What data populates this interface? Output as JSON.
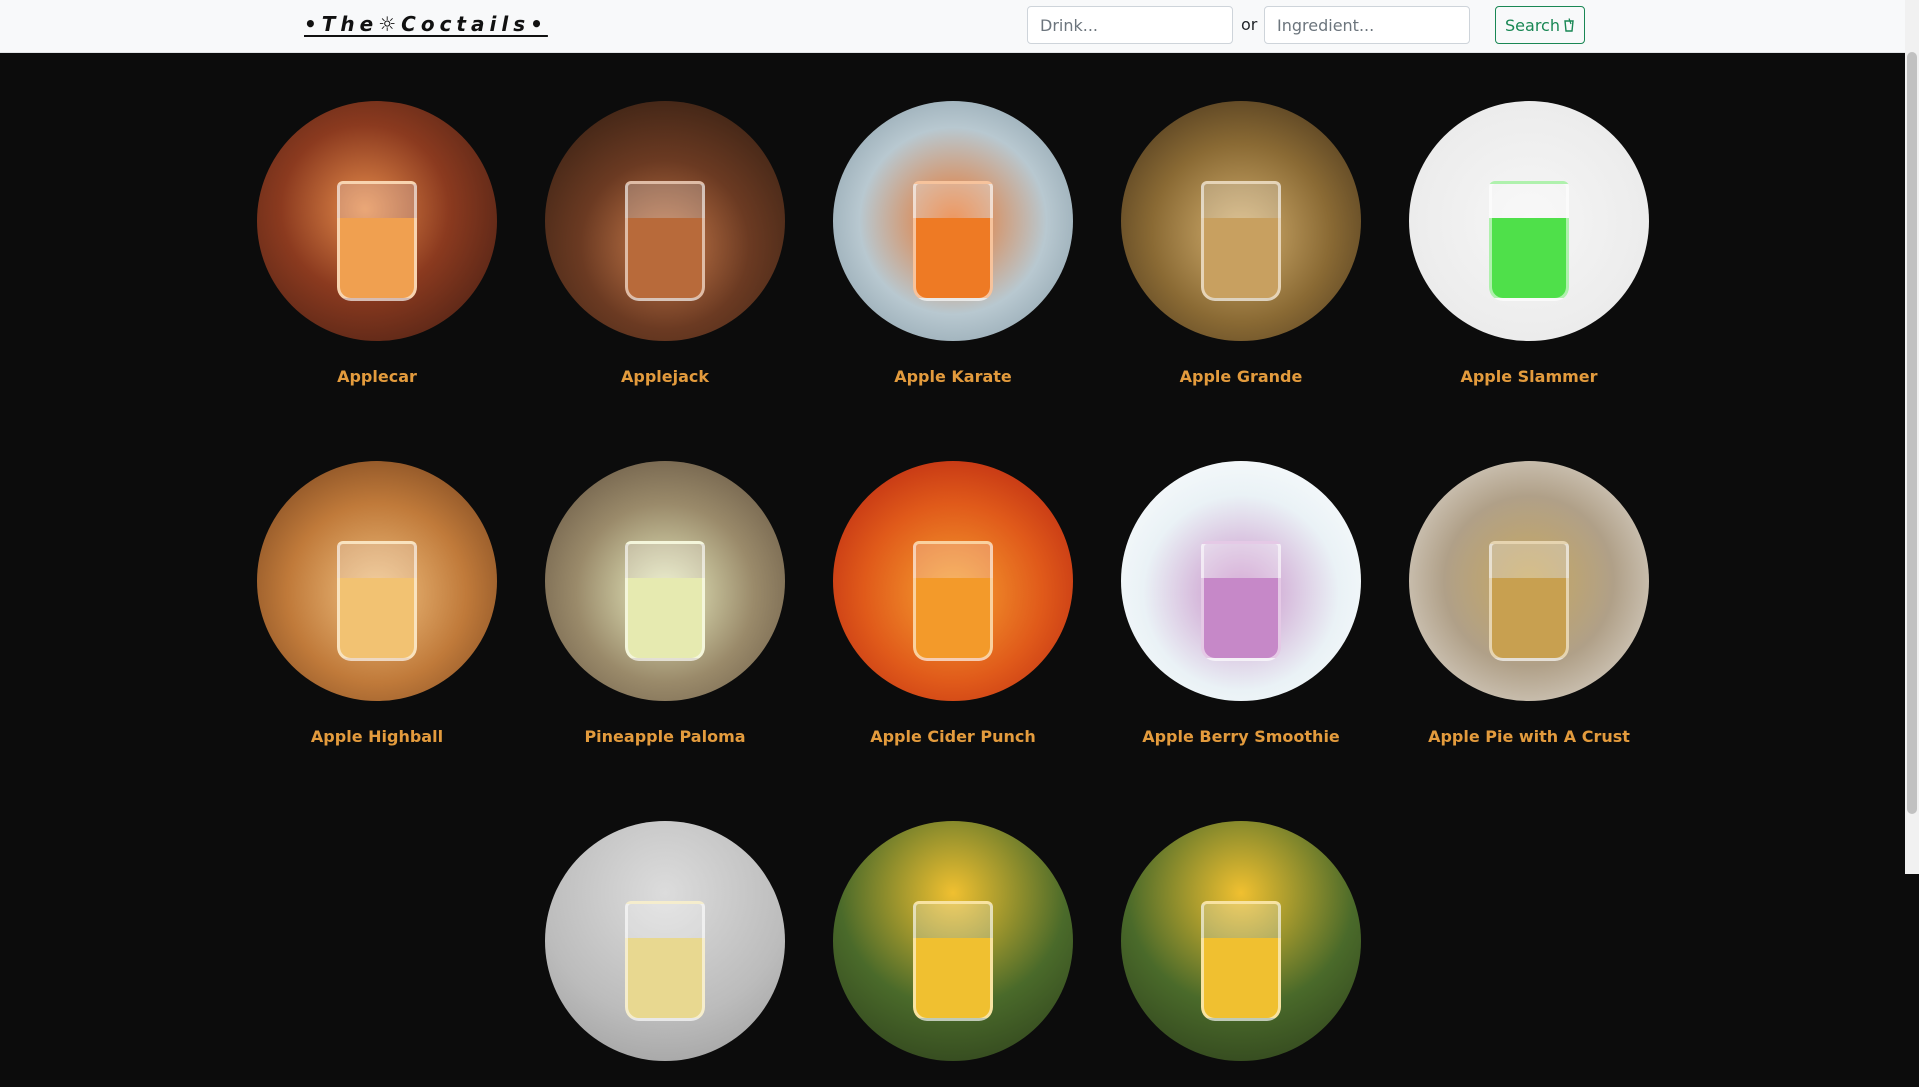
{
  "brand": "•The☼Coctails•",
  "search": {
    "drink_placeholder": "Drink...",
    "or_text": "or",
    "ingredient_placeholder": "Ingredient...",
    "button_label": "Search"
  },
  "drinks": [
    {
      "name": "Applecar",
      "bg": "radial-gradient(circle at 45% 45%, #e48a4a 0%, #8b3a1f 45%, #3a1a12 100%)",
      "liquid": "#f0a050"
    },
    {
      "name": "Applejack",
      "bg": "radial-gradient(circle at 50% 60%, #c77a4a 0%, #6b3a22 45%, #2a1a10 100%)",
      "liquid": "#b86a3a"
    },
    {
      "name": "Apple Karate",
      "bg": "radial-gradient(circle at 50% 50%, #e8742a 0%, #b8c8d0 55%, #7e94a0 100%)",
      "liquid": "#ee7a24"
    },
    {
      "name": "Apple Grande",
      "bg": "radial-gradient(circle at 50% 55%, #d4b070 0%, #8a6a34 50%, #3a2a18 100%)",
      "liquid": "#c8a060"
    },
    {
      "name": "Apple Slammer",
      "bg": "radial-gradient(circle at 50% 50%, #f6f6f6 0%, #ececec 70%, #dcdcdc 100%)",
      "liquid": "#4fe04a"
    },
    {
      "name": "Apple Highball",
      "bg": "radial-gradient(circle at 50% 55%, #f0c080 0%, #c07a3a 50%, #6a3a1a 100%)",
      "liquid": "#f2c272"
    },
    {
      "name": "Pineapple Paloma",
      "bg": "radial-gradient(circle at 50% 55%, #e8ecc0 0%, #9a8a6a 50%, #5a4a3a 100%)",
      "liquid": "#e6eab0"
    },
    {
      "name": "Apple Cider Punch",
      "bg": "radial-gradient(circle at 50% 55%, #f6a030 0%, #e05a1a 50%, #b01a10 100%)",
      "liquid": "#f39a2a"
    },
    {
      "name": "Apple Berry Smoothie",
      "bg": "radial-gradient(circle at 50% 55%, #c890c8 0%, #eaf2f6 55%, #ffffff 100%)",
      "liquid": "#c688c8"
    },
    {
      "name": "Apple Pie with A Crust",
      "bg": "radial-gradient(circle at 50% 50%, #c8a860 0%, #b0a088 50%, #e8e4de 100%)",
      "liquid": "#c8a050"
    },
    {
      "name": "",
      "bg": "radial-gradient(circle at 50% 30%, #dcdcdc 0%, #bcbcbc 60%, #9a9a9a 100%)",
      "liquid": "#e8d890"
    },
    {
      "name": "",
      "bg": "radial-gradient(circle at 50% 30%, #f0c030 0%, #4a6a2a 55%, #2a3a1a 100%)",
      "liquid": "#f0c030"
    },
    {
      "name": "",
      "bg": "radial-gradient(circle at 50% 30%, #f0c030 0%, #4a6a2a 55%, #2a3a1a 100%)",
      "liquid": "#f0c030"
    }
  ]
}
